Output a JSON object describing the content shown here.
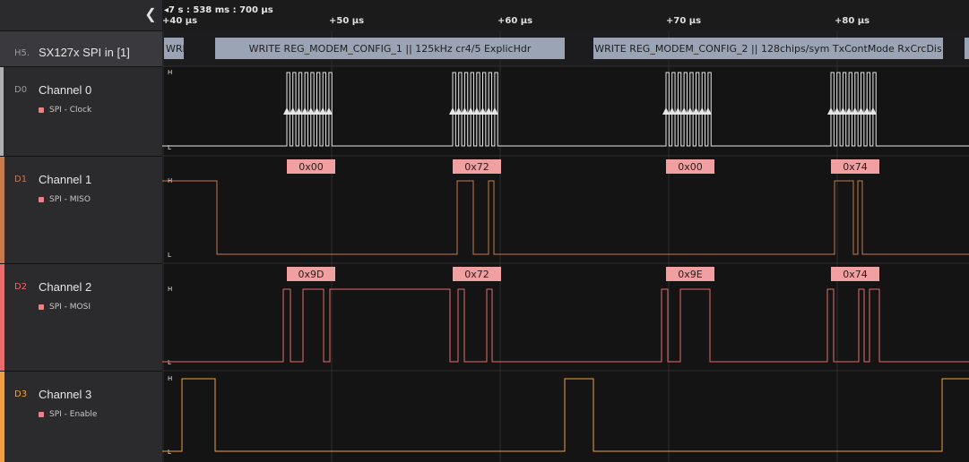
{
  "sidebar": {
    "collapse_icon": "chevron-left-icon",
    "analyzer": {
      "code": "H5.",
      "name": "SX127x SPI in [1]"
    },
    "channels": [
      {
        "code": "D0",
        "name": "Channel 0",
        "sub": "SPI - Clock",
        "color": "#e6e6e6",
        "code_color": "#9a9a9a"
      },
      {
        "code": "D1",
        "name": "Channel 1",
        "sub": "SPI - MISO",
        "color": "#c87a4a",
        "code_color": "#c87a4a"
      },
      {
        "code": "D2",
        "name": "Channel 2",
        "sub": "SPI - MOSI",
        "color": "#e86a6a",
        "code_color": "#e86a6a"
      },
      {
        "code": "D3",
        "name": "Channel 3",
        "sub": "SPI - Enable",
        "color": "#f0a040",
        "code_color": "#f0a040"
      }
    ]
  },
  "timeline": {
    "time_info": "◂7 s : 538 ms : 700 μs",
    "ticks": [
      "+40 μs",
      "+50 μs",
      "+60 μs",
      "+70 μs",
      "+80 μs"
    ]
  },
  "protocol": {
    "frames": [
      {
        "text": "WRI"
      },
      {
        "text": "WRITE REG_MODEM_CONFIG_1 || 125kHz cr4/5 ExplicHdr"
      },
      {
        "text": "WRITE REG_MODEM_CONFIG_2 || 128chips/sym TxContMode RxCrcDis"
      },
      {
        "text": ""
      }
    ]
  },
  "bytes": {
    "miso": [
      "0x00",
      "0x72",
      "0x00",
      "0x74"
    ],
    "mosi": [
      "0x9D",
      "0x72",
      "0x9E",
      "0x74"
    ]
  },
  "level_labels": {
    "high": "H",
    "low": "L"
  },
  "colors": {
    "clock": "#e6e6e6",
    "miso": "#c87a4a",
    "mosi": "#e86a6a",
    "enable": "#f0a040",
    "frame_bg": "#9aa4b4",
    "byte_bg": "#f0a0a0",
    "grid": "#2c2c2c"
  }
}
